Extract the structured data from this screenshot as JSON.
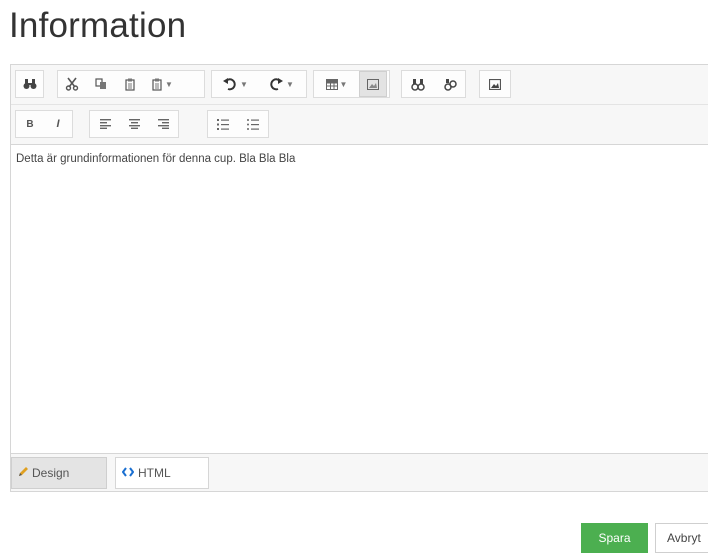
{
  "page": {
    "title": "Information"
  },
  "editor": {
    "content_text": "Detta är grundinformationen för denna cup. Bla Bla Bla",
    "toolbar_row1": [
      "find-icon",
      "cut-icon",
      "copy-icon",
      "paste-icon",
      "paste-dropdown-icon",
      "undo-icon",
      "redo-icon",
      "table-icon",
      "media-icon",
      "link-icon",
      "unlink-icon",
      "image-icon"
    ],
    "toolbar_row2": [
      "bold-icon",
      "italic-icon",
      "align-left-icon",
      "align-center-icon",
      "align-right-icon",
      "ordered-list-icon",
      "unordered-list-icon"
    ],
    "labels": {
      "bold": "B",
      "italic": "I"
    },
    "modes": {
      "design": "Design",
      "html": "HTML",
      "active": "design"
    }
  },
  "actions": {
    "save": "Spara",
    "cancel": "Avbryt"
  },
  "colors": {
    "save_bg": "#4caf50",
    "toolbar_bg": "#f7f7f7"
  }
}
